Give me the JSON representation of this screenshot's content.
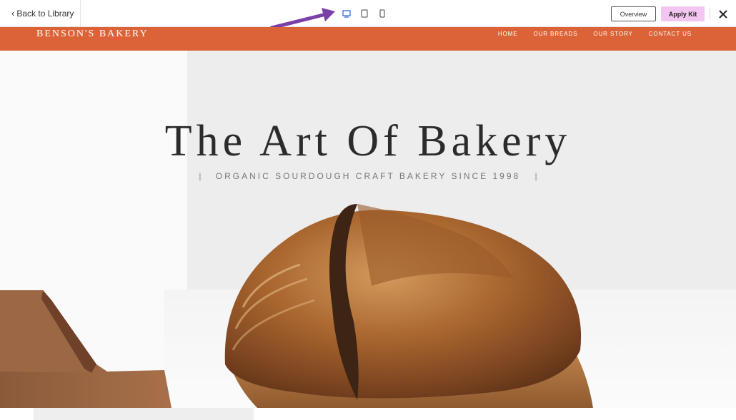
{
  "toolbar": {
    "back_label": "Back to Library",
    "devices": [
      "desktop-icon",
      "tablet-icon",
      "mobile-icon"
    ],
    "overview_label": "Overview",
    "apply_label": "Apply Kit",
    "accent_color": "#2f6fd6",
    "apply_color": "#f2c6f0",
    "arrow_color": "#7b3fa8"
  },
  "site": {
    "logo": "BENSON'S BAKERY",
    "nav_color": "#dc6337",
    "menu": [
      "HOME",
      "OUR BREADS",
      "OUR STORY",
      "CONTACT US"
    ]
  },
  "hero": {
    "title": "The Art Of Bakery",
    "subtitle": "ORGANIC SOURDOUGH CRAFT BAKERY SINCE 1998",
    "image": "sourdough-bread-photo"
  }
}
